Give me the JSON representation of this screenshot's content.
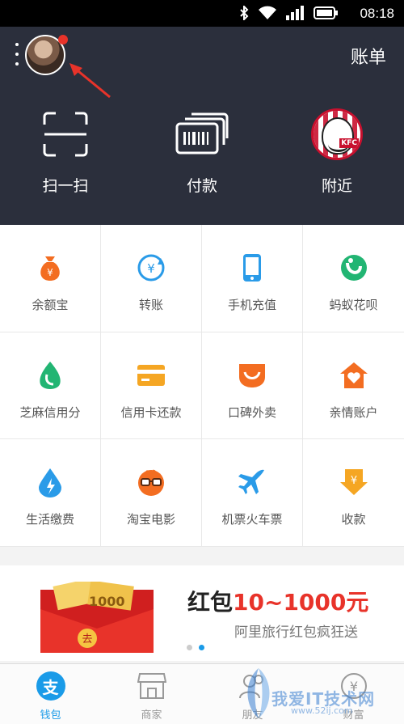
{
  "status_bar": {
    "time": "08:18"
  },
  "header": {
    "bill_label": "账单"
  },
  "quick_actions": [
    {
      "label": "扫一扫",
      "icon": "scan-icon"
    },
    {
      "label": "付款",
      "icon": "barcode-icon"
    },
    {
      "label": "附近",
      "icon": "kfc-logo-icon"
    }
  ],
  "services": [
    {
      "label": "余额宝",
      "icon": "money-bag-icon",
      "color": "#f36d21"
    },
    {
      "label": "转账",
      "icon": "transfer-icon",
      "color": "#2a9be8"
    },
    {
      "label": "手机充值",
      "icon": "mobile-icon",
      "color": "#2a9be8"
    },
    {
      "label": "蚂蚁花呗",
      "icon": "huabei-icon",
      "color": "#22b573"
    },
    {
      "label": "芝麻信用分",
      "icon": "sesame-icon",
      "color": "#22b573"
    },
    {
      "label": "信用卡还款",
      "icon": "credit-card-icon",
      "color": "#f5a623"
    },
    {
      "label": "口碑外卖",
      "icon": "koubei-icon",
      "color": "#f36d21"
    },
    {
      "label": "亲情账户",
      "icon": "family-home-icon",
      "color": "#f36d21"
    },
    {
      "label": "生活缴费",
      "icon": "utility-drop-icon",
      "color": "#2a9be8"
    },
    {
      "label": "淘宝电影",
      "icon": "movie-glasses-icon",
      "color": "#f36d21"
    },
    {
      "label": "机票火车票",
      "icon": "airplane-icon",
      "color": "#2a9be8"
    },
    {
      "label": "收款",
      "icon": "receive-money-icon",
      "color": "#f5a623"
    }
  ],
  "banner": {
    "title_prefix": "红包",
    "title_amount": "10~1000元",
    "subtitle": "阿里旅行红包疯狂送",
    "badge": "去",
    "note_value": "1000"
  },
  "tabs": [
    {
      "label": "钱包",
      "icon": "wallet-icon",
      "active": true
    },
    {
      "label": "商家",
      "icon": "store-icon",
      "active": false
    },
    {
      "label": "朋友",
      "icon": "friends-icon",
      "active": false
    },
    {
      "label": "财富",
      "icon": "wealth-icon",
      "active": false
    }
  ],
  "watermark": {
    "text": "我爱IT技术网",
    "url": "www.52ij.com"
  },
  "colors": {
    "header_bg": "#2b2f3c",
    "accent": "#1a9be8",
    "badge_red": "#e8332a"
  }
}
